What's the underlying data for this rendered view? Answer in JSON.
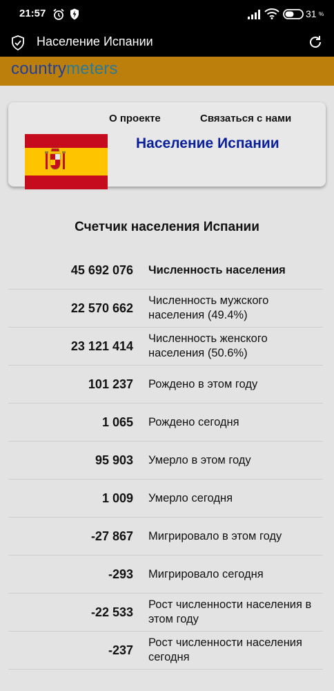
{
  "status_bar": {
    "time": "21:57",
    "battery": "31",
    "battery_unit": "%"
  },
  "app_bar": {
    "title": "Население Испании"
  },
  "brand": {
    "logo_part1": "country",
    "logo_part2": "meters"
  },
  "header_card": {
    "nav_about": "О проекте",
    "nav_contact": "Связаться с нами",
    "page_title": "Население Испании"
  },
  "counter": {
    "heading": "Счетчик населения Испании",
    "rows": [
      {
        "value": "45 692 076",
        "label": "Численность населения"
      },
      {
        "value": "22 570 662",
        "label": "Численность мужского населения (49.4%)"
      },
      {
        "value": "23 121 414",
        "label": "Численность женского населения (50.6%)"
      },
      {
        "value": "101 237",
        "label": "Рождено в этом году"
      },
      {
        "value": "1 065",
        "label": "Рождено сегодня"
      },
      {
        "value": "95 903",
        "label": "Умерло в этом году"
      },
      {
        "value": "1 009",
        "label": "Умерло сегодня"
      },
      {
        "value": "-27 867",
        "label": "Мигрировало в этом году"
      },
      {
        "value": "-293",
        "label": "Мигрировало сегодня"
      },
      {
        "value": "-22 533",
        "label": "Рост численности населения в этом году"
      },
      {
        "value": "-237",
        "label": "Рост численности населения сегодня"
      }
    ]
  },
  "colors": {
    "brand_bar": "#bc7f0c",
    "title_blue": "#0a1f9a",
    "flag_red": "#c60b1e",
    "flag_yellow": "#ffc400"
  },
  "icons": [
    "alarm-icon",
    "shield-bolt-icon",
    "signal-icon",
    "wifi-icon",
    "toggle-icon",
    "shield-check-icon",
    "refresh-icon"
  ]
}
